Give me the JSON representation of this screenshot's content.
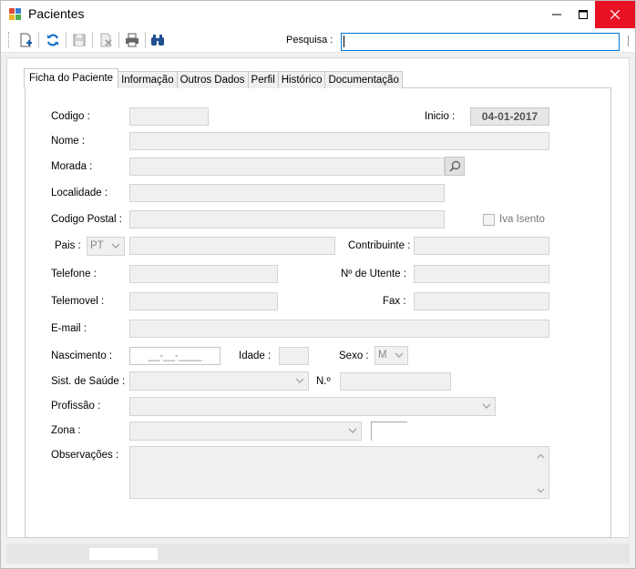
{
  "window": {
    "title": "Pacientes",
    "minimize_glyph": "—",
    "maximize_glyph": "☐",
    "close_glyph": "✕"
  },
  "toolbar": {
    "icons": [
      "new-document-icon",
      "refresh-icon",
      "save-icon",
      "delete-icon",
      "print-icon",
      "binoculars-icon"
    ],
    "search_label": "Pesquisa :",
    "search_value": ""
  },
  "tabs": [
    "Ficha do Paciente",
    "Informação",
    "Outros Dados",
    "Perfil",
    "Histórico",
    "Documentação"
  ],
  "form": {
    "codigo_label": "Codigo :",
    "codigo_value": "",
    "inicio_label": "Inicio :",
    "inicio_value": "04-01-2017",
    "nome_label": "Nome :",
    "morada_label": "Morada :",
    "localidade_label": "Localidade :",
    "codigo_postal_label": "Codigo Postal :",
    "iva_isento_label": "Iva Isento",
    "pais_label": "Pais :",
    "pais_value": "PT",
    "contribuinte_label": "Contribuinte :",
    "telefone_label": "Telefone :",
    "utente_label": "Nº de Utente :",
    "telemovel_label": "Telemovel :",
    "fax_label": "Fax :",
    "email_label": "E-mail :",
    "nascimento_label": "Nascimento :",
    "nascimento_mask": "__-__-____",
    "idade_label": "Idade :",
    "sexo_label": "Sexo :",
    "sexo_value": "M",
    "sist_saude_label": "Sist. de Saúde :",
    "numero_label": "N.º",
    "profissao_label": "Profissão :",
    "zona_label": "Zona :",
    "observacoes_label": "Observações :"
  },
  "colors": {
    "accent": "#0078d7",
    "close": "#e81123",
    "disabled_field": "#f0f0f0"
  }
}
